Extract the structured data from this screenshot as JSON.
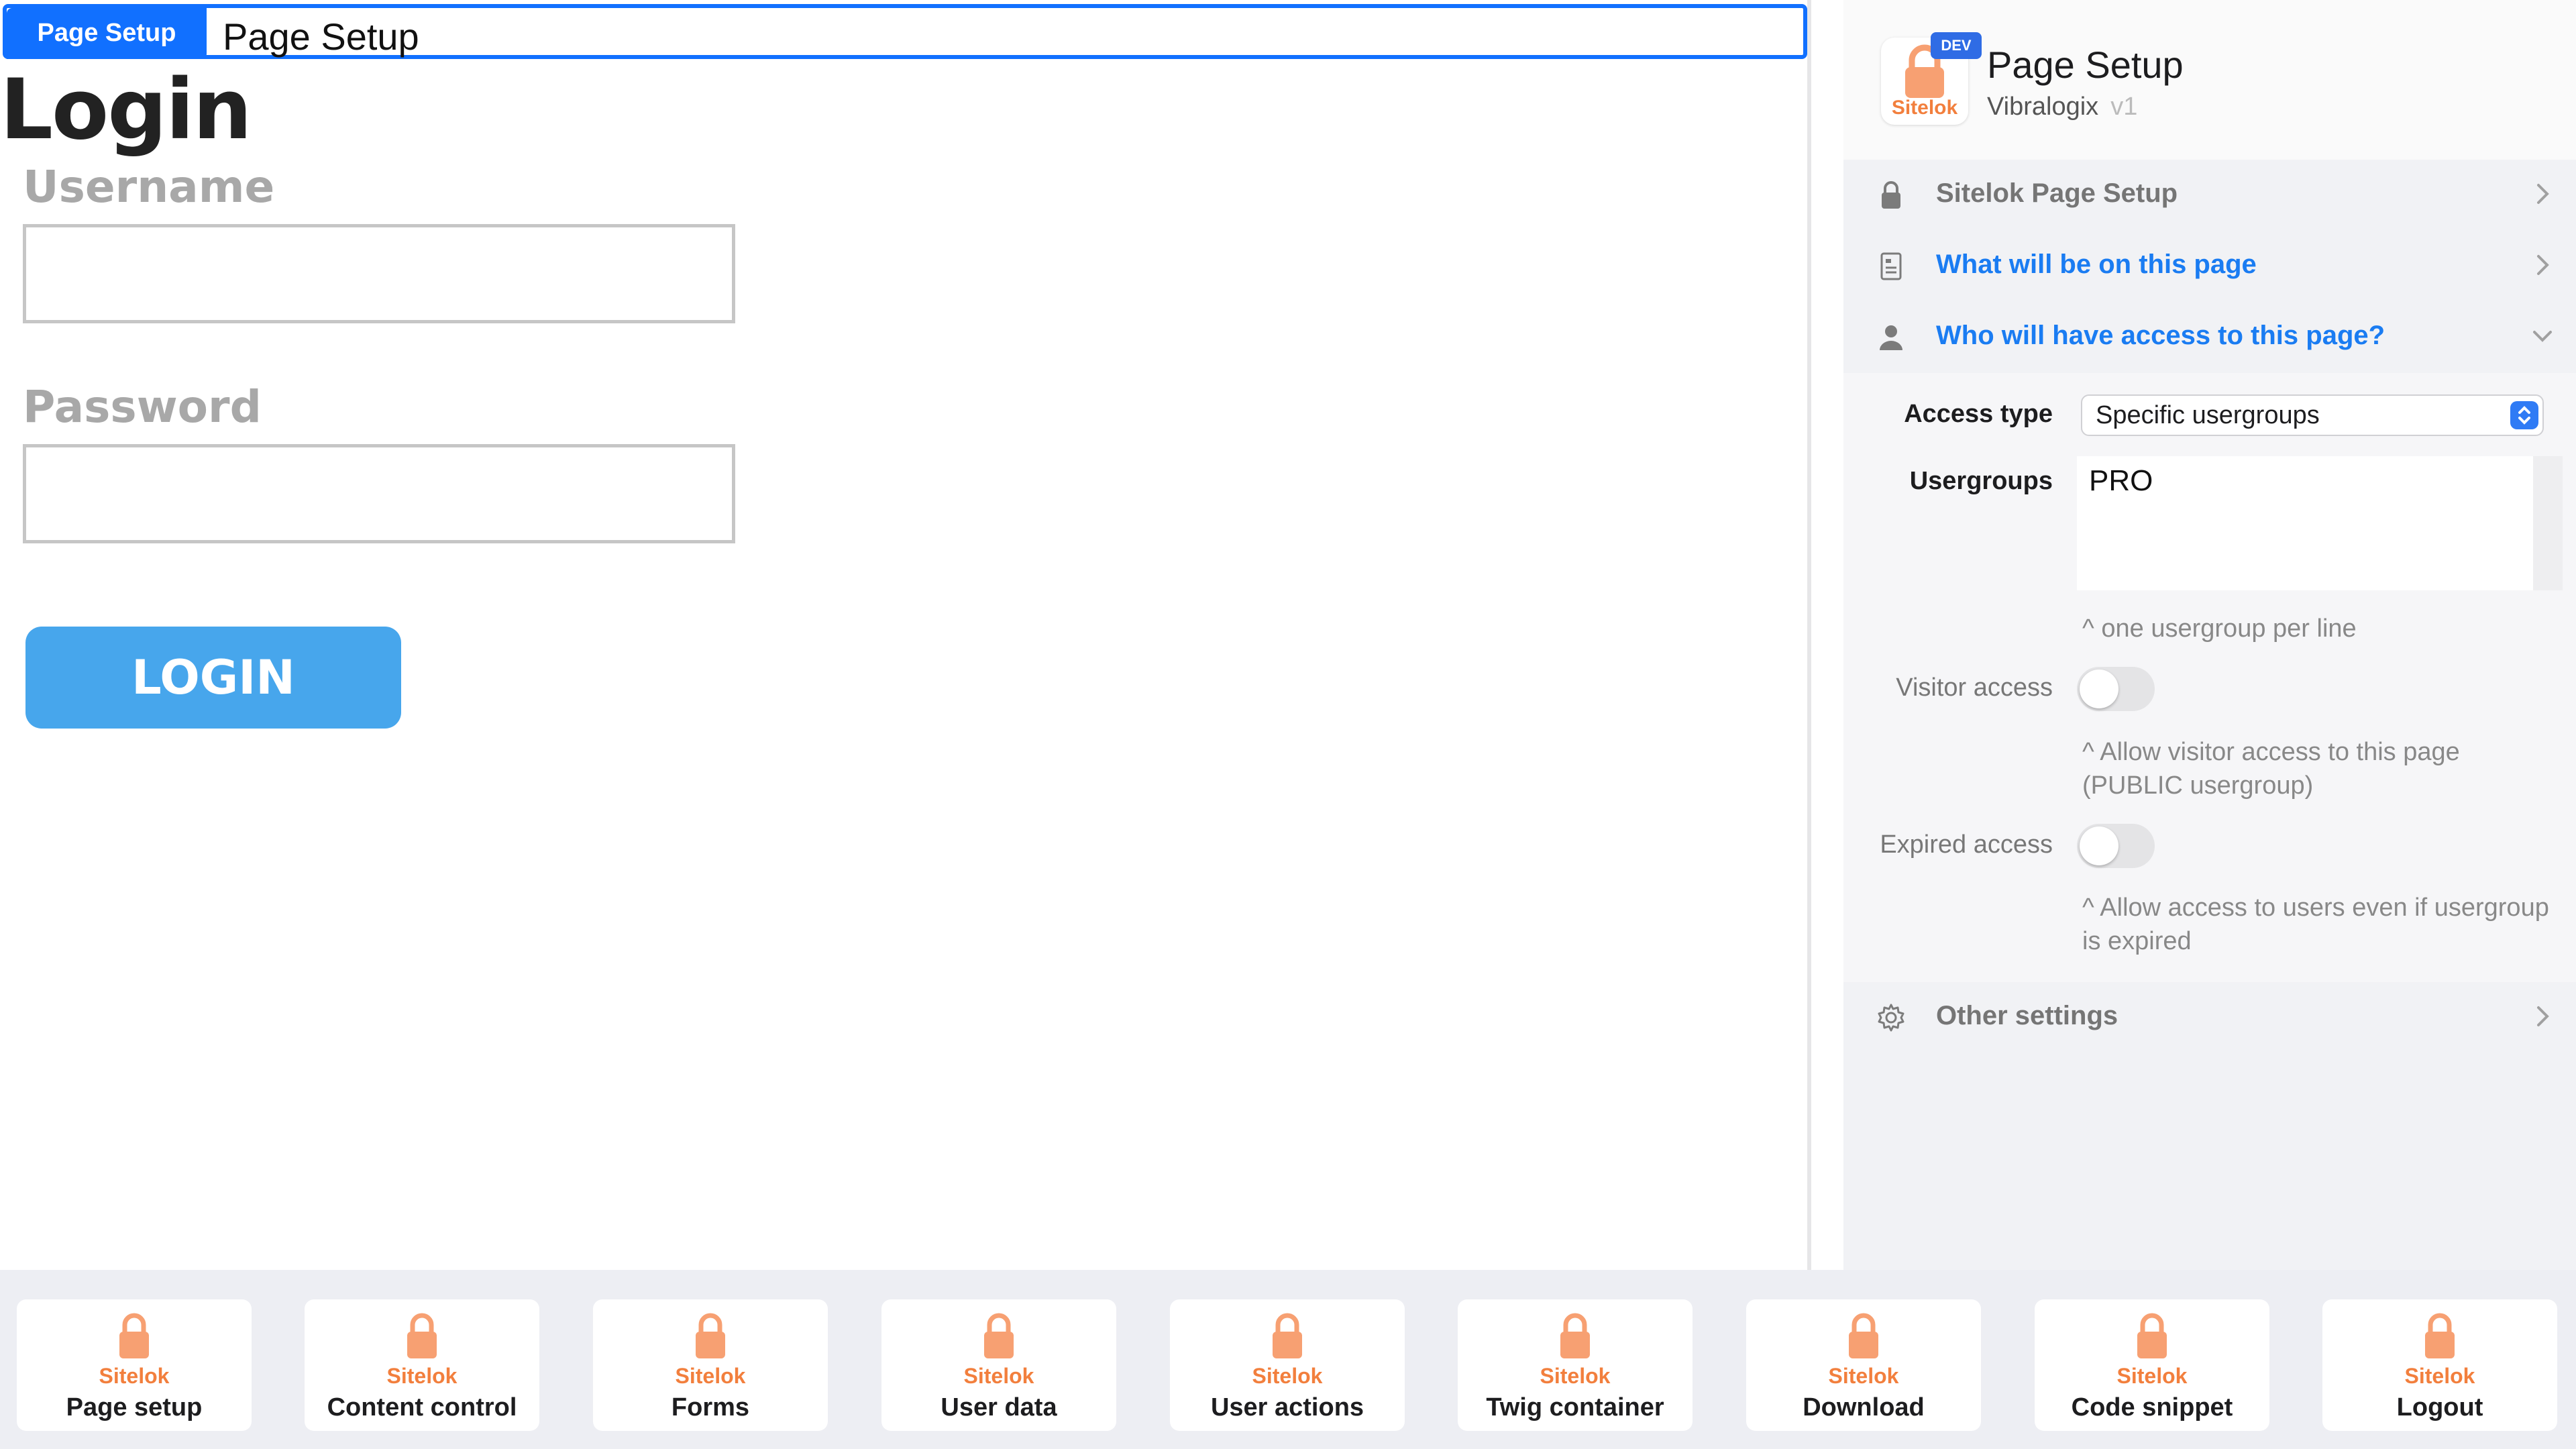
{
  "canvas": {
    "selection": {
      "badge": "Page Setup",
      "text": "Page Setup"
    },
    "login_title": "Login",
    "username_label": "Username",
    "password_label": "Password",
    "login_button": "LOGIN"
  },
  "panel": {
    "header": {
      "title": "Page Setup",
      "vendor": "Vibralogix",
      "version": "v1",
      "icon_label": "Sitelok",
      "badge": "DEV"
    },
    "sections": [
      {
        "label": "Sitelok Page Setup",
        "icon": "lock-icon",
        "state": "collapsed"
      },
      {
        "label": "What will be on this page",
        "icon": "document-icon",
        "state": "collapsed"
      },
      {
        "label": "Who will have access to this page?",
        "icon": "person-icon",
        "state": "expanded"
      },
      {
        "label": "Other settings",
        "icon": "gear-icon",
        "state": "collapsed"
      }
    ],
    "access": {
      "access_type_label": "Access type",
      "access_type_value": "Specific usergroups",
      "usergroups_label": "Usergroups",
      "usergroups_value": "PRO",
      "usergroups_hint": "^ one usergroup per line",
      "visitor_label": "Visitor access",
      "visitor_on": false,
      "visitor_hint": "^ Allow visitor access to this page (PUBLIC usergroup)",
      "expired_label": "Expired access",
      "expired_on": false,
      "expired_hint": "^ Allow access to users even if usergroup is expired"
    }
  },
  "blocks": [
    {
      "brand": "Sitelok",
      "label": "Page setup"
    },
    {
      "brand": "Sitelok",
      "label": "Content control"
    },
    {
      "brand": "Sitelok",
      "label": "Forms"
    },
    {
      "brand": "Sitelok",
      "label": "User data"
    },
    {
      "brand": "Sitelok",
      "label": "User actions"
    },
    {
      "brand": "Sitelok",
      "label": "Twig container"
    },
    {
      "brand": "Sitelok",
      "label": "Download"
    },
    {
      "brand": "Sitelok",
      "label": "Code snippet"
    },
    {
      "brand": "Sitelok",
      "label": "Logout"
    }
  ],
  "colors": {
    "accent_blue": "#1a7cf2",
    "selection_blue": "#1170ff",
    "sitelok_orange": "#f27f3d",
    "login_button": "#47a6ec"
  }
}
